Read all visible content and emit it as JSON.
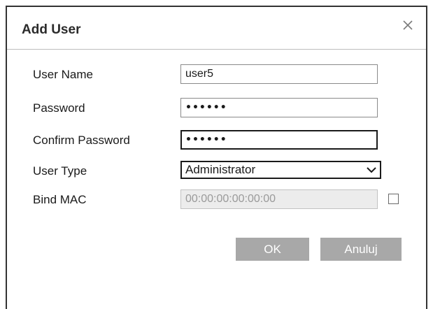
{
  "dialog": {
    "title": "Add User",
    "close_icon": "close-icon"
  },
  "form": {
    "user_name": {
      "label": "User Name",
      "value": "user5"
    },
    "password": {
      "label": "Password",
      "value": "••••••"
    },
    "confirm_password": {
      "label": "Confirm Password",
      "value": "••••••"
    },
    "user_type": {
      "label": "User Type",
      "value": "Administrator",
      "icon": "chevron-down-icon"
    },
    "bind_mac": {
      "label": "Bind MAC",
      "value": "00:00:00:00:00:00",
      "checked": false
    }
  },
  "buttons": {
    "ok_label": "OK",
    "cancel_label": "Anuluj",
    "color": "#a8a8a8"
  }
}
